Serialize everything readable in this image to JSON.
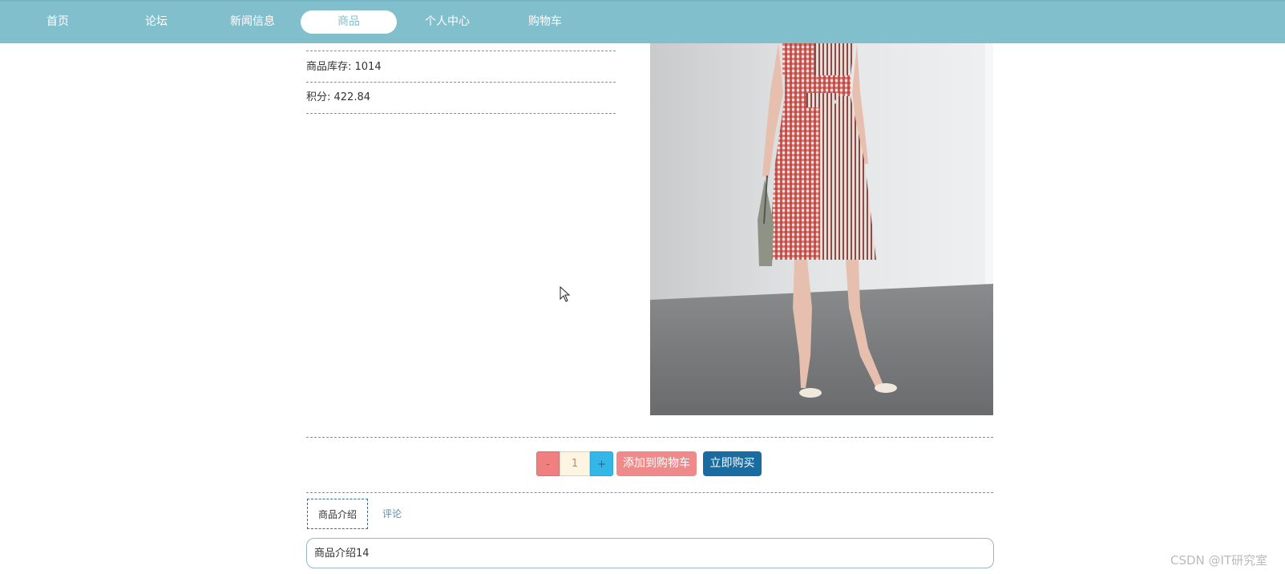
{
  "nav": {
    "items": [
      {
        "label": "首页",
        "active": false
      },
      {
        "label": "论坛",
        "active": false
      },
      {
        "label": "新闻信息",
        "active": false
      },
      {
        "label": "商品",
        "active": true
      },
      {
        "label": "个人中心",
        "active": false
      },
      {
        "label": "购物车",
        "active": false
      }
    ]
  },
  "product": {
    "stock_text": "商品库存: 1014",
    "points_text": "积分: 422.84"
  },
  "purchase": {
    "minus_label": "-",
    "quantity": "1",
    "plus_label": "+",
    "add_to_cart_label": "添加到购物车",
    "buy_now_label": "立即购买"
  },
  "tabs": {
    "intro_label": "商品介绍",
    "comments_label": "评论"
  },
  "description": "商品介绍14",
  "watermark": "CSDN @IT研究室",
  "colors": {
    "nav_bg": "#82bfcc",
    "add_cart": "#f08a8a",
    "buy_now": "#196ba0",
    "plus": "#33b6e8",
    "minus": "#f07f7f"
  }
}
